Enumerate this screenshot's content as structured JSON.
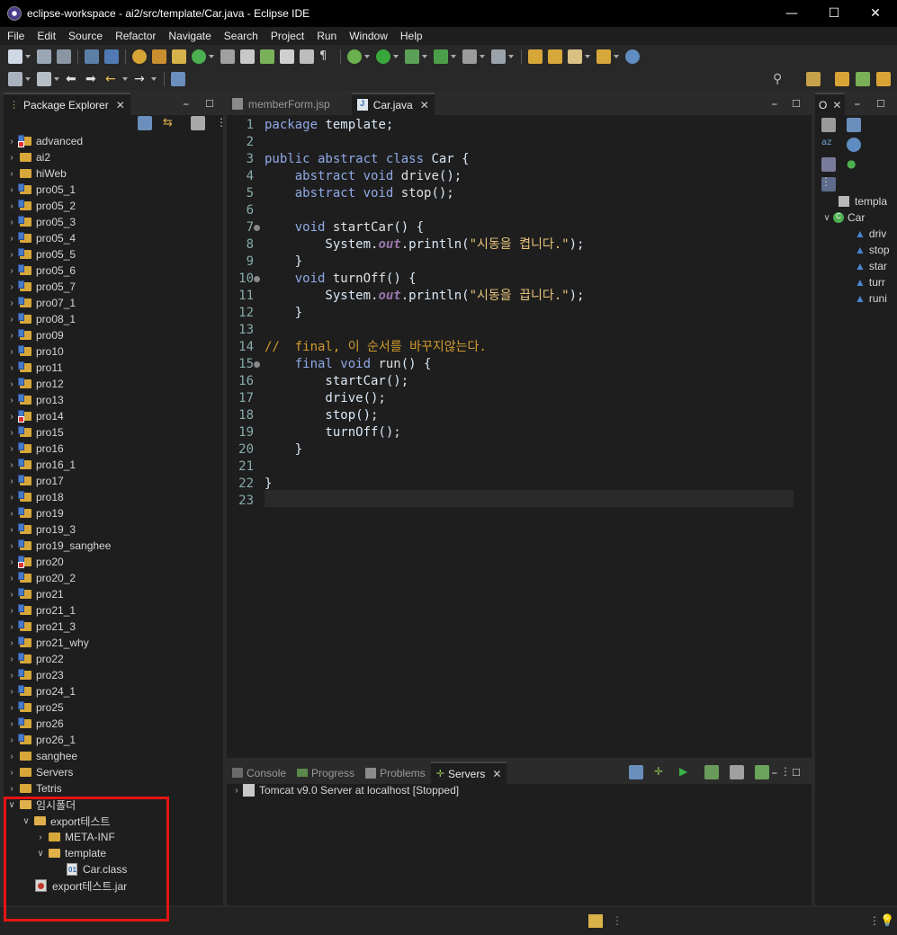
{
  "window": {
    "title": "eclipse-workspace - ai2/src/template/Car.java - Eclipse IDE"
  },
  "menu": [
    "File",
    "Edit",
    "Source",
    "Refactor",
    "Navigate",
    "Search",
    "Project",
    "Run",
    "Window",
    "Help"
  ],
  "package_explorer": {
    "tab_label": "Package Explorer",
    "projects": [
      "advanced",
      "ai2",
      "hiWeb",
      "pro05_1",
      "pro05_2",
      "pro05_3",
      "pro05_4",
      "pro05_5",
      "pro05_6",
      "pro05_7",
      "pro07_1",
      "pro08_1",
      "pro09",
      "pro10",
      "pro11",
      "pro12",
      "pro13",
      "pro14",
      "pro15",
      "pro16",
      "pro16_1",
      "pro17",
      "pro18",
      "pro19",
      "pro19_3",
      "pro19_sanghee",
      "pro20",
      "pro20_2",
      "pro21",
      "pro21_1",
      "pro21_3",
      "pro21_why",
      "pro22",
      "pro23",
      "pro24_1",
      "pro25",
      "pro26",
      "pro26_1",
      "sanghee",
      "Servers",
      "Tetris"
    ],
    "temp_folder": {
      "label": "임시폴더",
      "export_folder": "export테스트",
      "meta_inf": "META-INF",
      "template": "template",
      "car_class": "Car.class",
      "jar": "export테스트.jar"
    }
  },
  "editor": {
    "tabs": [
      {
        "label": "memberForm.jsp"
      },
      {
        "label": "Car.java"
      }
    ],
    "line_numbers": [
      "1",
      "2",
      "3",
      "4",
      "5",
      "6",
      "7",
      "8",
      "9",
      "10",
      "11",
      "12",
      "13",
      "14",
      "15",
      "16",
      "17",
      "18",
      "19",
      "20",
      "21",
      "22",
      "23"
    ]
  },
  "outline": {
    "tab_label": "O",
    "items": [
      "templa",
      "Car",
      "driv",
      "stop",
      "star",
      "turr",
      "runi"
    ]
  },
  "bottom": {
    "tabs": [
      "Console",
      "Progress",
      "Problems",
      "Servers"
    ],
    "server_entry": "Tomcat v9.0 Server at localhost  [Stopped]"
  },
  "colors": {
    "highlight_box": "#e51414",
    "folder": "#d7a73a",
    "java": "#4a7cc7"
  }
}
